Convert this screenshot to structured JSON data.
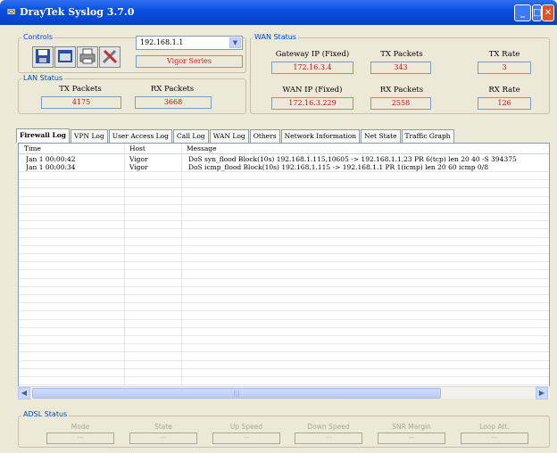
{
  "window": {
    "title": "DrayTek Syslog 3.7.0",
    "icon": "app-icon"
  },
  "controls": {
    "label": "Controls",
    "router_select": "192.168.1.1",
    "router_series": "Vigor Series",
    "tools": [
      "save-icon",
      "folder-icon",
      "printer-icon",
      "settings-icon"
    ]
  },
  "wan_status": {
    "label": "WAN Status",
    "gateway_ip_label": "Gateway IP (Fixed)",
    "gateway_ip": "172.16.3.4",
    "wan_ip_label": "WAN IP (Fixed)",
    "wan_ip": "172.16.3.229",
    "tx_packets_label": "TX Packets",
    "tx_packets": "343",
    "rx_packets_label": "RX Packets",
    "rx_packets": "2558",
    "tx_rate_label": "TX Rate",
    "tx_rate": "3",
    "rx_rate_label": "RX Rate",
    "rx_rate": "126"
  },
  "lan_status": {
    "label": "LAN Status",
    "tx_packets_label": "TX Packets",
    "tx_packets": "4175",
    "rx_packets_label": "RX Packets",
    "rx_packets": "3668"
  },
  "tabs": [
    "Firewall Log",
    "VPN Log",
    "User Access Log",
    "Call Log",
    "WAN Log",
    "Others",
    "Network Information",
    "Net State",
    "Traffic Graph"
  ],
  "log_table": {
    "columns": [
      "Time",
      "Host",
      "Message"
    ],
    "rows": [
      {
        "time": "Jan  1 00:00:42",
        "host": "Vigor",
        "message": "DoS syn_flood Block(10s) 192.168.1.115,10605 -> 192.168.1.1,23 PR 6(tcp) len 20 40 -S 394375"
      },
      {
        "time": "Jan  1 00:00:34",
        "host": "Vigor",
        "message": "DoS icmp_flood Block(10s) 192.168.1.115 -> 192.168.1.1 PR 1(icmp) len 20 60 icmp 0/8"
      }
    ]
  },
  "adsl_status": {
    "label": "ADSL Status",
    "fields": [
      {
        "label": "Mode",
        "value": "---"
      },
      {
        "label": "State",
        "value": "---"
      },
      {
        "label": "Up Speed",
        "value": "---"
      },
      {
        "label": "Down Speed",
        "value": "---"
      },
      {
        "label": "SNR Margin",
        "value": "---"
      },
      {
        "label": "Loop Att.",
        "value": "---"
      }
    ]
  }
}
